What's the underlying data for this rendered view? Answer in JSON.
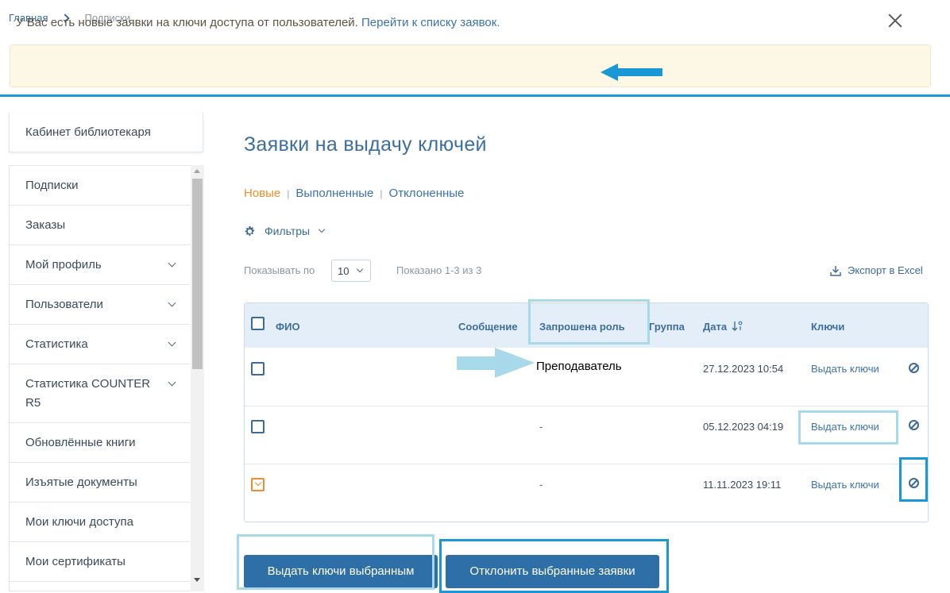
{
  "breadcrumb": {
    "home": "Главная",
    "current": "Подписки"
  },
  "notice": {
    "text": "У Вас есть новые заявки на ключи доступа от пользователей.",
    "link": "Перейти к списку заявок."
  },
  "sidebar": {
    "cabinet": "Кабинет библиотекаря",
    "items": [
      {
        "label": "Подписки"
      },
      {
        "label": "Заказы"
      },
      {
        "label": "Мой профиль"
      },
      {
        "label": "Пользователи"
      },
      {
        "label": "Статистика"
      },
      {
        "label": "Статистика COUNTER R5"
      },
      {
        "label": "Обновлённые книги"
      },
      {
        "label": "Изъятые документы"
      },
      {
        "label": "Мои ключи доступа"
      },
      {
        "label": "Мои сертификаты"
      }
    ]
  },
  "main": {
    "title": "Заявки на выдачу ключей",
    "tabs": [
      "Новые",
      "Выполненные",
      "Отклоненные"
    ],
    "filters_label": "Фильтры",
    "per_page_label": "Показывать по",
    "per_page_value": "10",
    "shown_text": "Показано 1-3 из 3",
    "export_label": "Экспорт в Excel"
  },
  "table": {
    "headers": {
      "name": "ФИО",
      "message": "Сообщение",
      "role": "Запрошена роль",
      "group": "Группа",
      "date": "Дата",
      "keys": "Ключи"
    },
    "rows": [
      {
        "role": "Преподаватель",
        "date": "27.12.2023 10:54",
        "action": "Выдать ключи",
        "checked": false
      },
      {
        "role": "-",
        "date": "05.12.2023 04:19",
        "action": "Выдать ключи",
        "checked": false
      },
      {
        "role": "-",
        "date": "11.11.2023 19:11",
        "action": "Выдать ключи",
        "checked": true
      }
    ]
  },
  "buttons": {
    "issue_selected": "Выдать ключи выбранным",
    "reject_selected": "Отклонить выбранные заявки"
  },
  "colors": {
    "accent": "#2f6fa8",
    "active_tab": "#f08c2c",
    "highlight_light": "#a8d9ea",
    "highlight_dark": "#1a98d5"
  }
}
